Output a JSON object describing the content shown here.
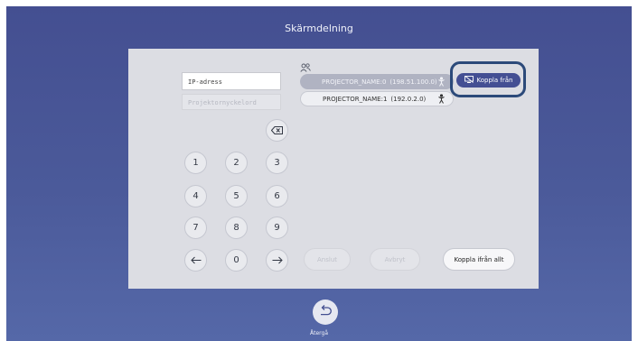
{
  "screen": {
    "title": "Skärmdelning",
    "colors": {
      "background": "#4b5a9a",
      "panel": "#dcdde3",
      "accent": "#444f93",
      "highlight_outline": "#2c4a7a"
    }
  },
  "form": {
    "ip_value": "IP-adress",
    "keyword_placeholder": "Projektornyckelord"
  },
  "keypad": {
    "backspace_icon": "backspace-icon",
    "digits": [
      "1",
      "2",
      "3",
      "4",
      "5",
      "6",
      "7",
      "8",
      "9"
    ],
    "zero": "0",
    "left_icon": "arrow-left-icon",
    "right_icon": "arrow-right-icon"
  },
  "projectors": {
    "header_icon": "users-icon",
    "items": [
      {
        "name": "PROJECTOR_NAME:0",
        "address": "(198.51.100.0)",
        "icon": "presenter-icon",
        "selected": true
      },
      {
        "name": "PROJECTOR_NAME:1",
        "address": "(192.0.2.0)",
        "icon": "presenter-icon",
        "selected": false
      }
    ],
    "disconnect_label": "Koppla från",
    "disconnect_icon": "screen-off-icon"
  },
  "actions": {
    "connect": "Anslut",
    "cancel": "Avbryt",
    "disconnect_all": "Koppla ifrån allt"
  },
  "footer": {
    "back_label": "Återgå",
    "back_icon": "return-icon"
  }
}
